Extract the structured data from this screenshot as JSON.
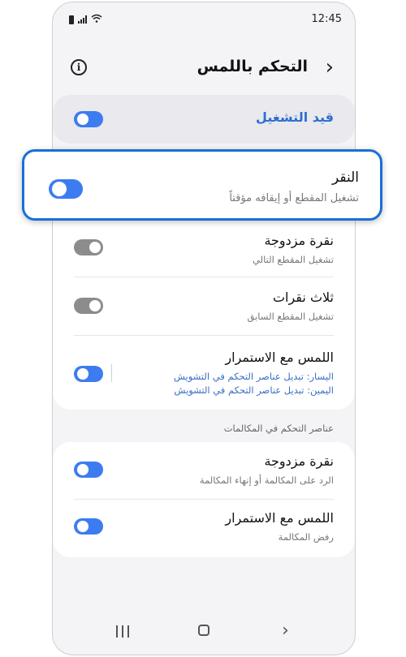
{
  "status_bar": {
    "time": "12:45"
  },
  "header": {
    "title": "التحكم باللمس",
    "info_icon": "info-icon",
    "back_icon": "chevron-right-icon"
  },
  "master": {
    "label": "قيد التشغيل",
    "toggle_on": true
  },
  "tap": {
    "label": "النقر",
    "sub": "تشغيل المقطع أو إيقافه مؤقتاً",
    "toggle_on": true
  },
  "main_items": [
    {
      "label": "نقرة مزدوجة",
      "sub": "تشغيل المقطع التالي",
      "toggle_on": false
    },
    {
      "label": "ثلاث نقرات",
      "sub": "تشغيل المقطع السابق",
      "toggle_on": false
    },
    {
      "label": "اللمس مع الاستمرار",
      "sub_left": "اليسار: تبديل عناصر التحكم في التشويش",
      "sub_right": "اليمين: تبديل عناصر التحكم في التشويش",
      "toggle_on": true
    }
  ],
  "calls_section": {
    "header": "عناصر التحكم في المكالمات",
    "items": [
      {
        "label": "نقرة مزدوجة",
        "sub": "الرد على المكالمة أو إنهاء المكالمة",
        "toggle_on": true
      },
      {
        "label": "اللمس مع الاستمرار",
        "sub": "رفض المكالمة",
        "toggle_on": true
      }
    ]
  },
  "colors": {
    "accent": "#3d7cf0",
    "highlight_border": "#1a6fd6",
    "master_label": "#2e6fd0",
    "toggle_off": "#8c8c8c"
  },
  "nav": {
    "recents_icon": "recents-icon",
    "home_icon": "home-icon",
    "back_icon": "back-icon"
  }
}
